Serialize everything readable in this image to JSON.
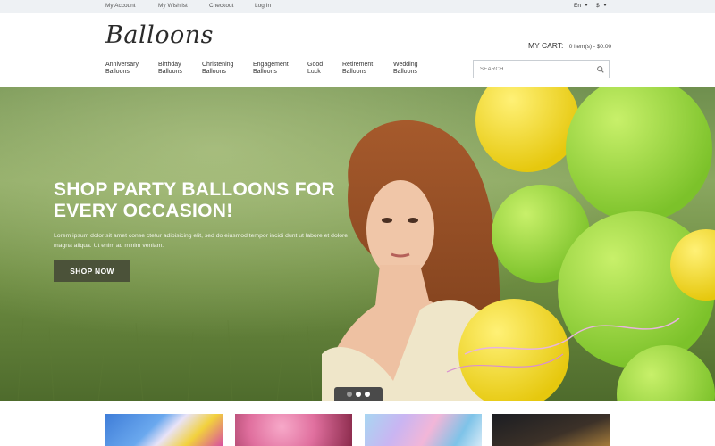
{
  "topbar": {
    "links": [
      "My Account",
      "My Wishlist",
      "Checkout",
      "Log In"
    ],
    "language": "En",
    "currency": "$"
  },
  "logo": "Balloons",
  "cart": {
    "label": "MY CART:",
    "summary": "0 item(s) - $0.00"
  },
  "nav": [
    {
      "line1": "Anniversary",
      "line2": "Balloons"
    },
    {
      "line1": "Birthday",
      "line2": "Balloons"
    },
    {
      "line1": "Christening",
      "line2": "Balloons"
    },
    {
      "line1": "Engagement",
      "line2": "Balloons"
    },
    {
      "line1": "Good",
      "line2": "Luck"
    },
    {
      "line1": "Retirement",
      "line2": "Balloons"
    },
    {
      "line1": "Wedding",
      "line2": "Balloons"
    }
  ],
  "search": {
    "placeholder": "SEARCH"
  },
  "hero": {
    "title": "SHOP PARTY BALLOONS FOR EVERY OCCASION!",
    "text": "Lorem ipsum dolor sit amet conse ctetur adipisicing elit, sed do eiusmod tempor incidi dunt ut labore et dolore magna aliqua. Ut enim ad minim veniam.",
    "button": "SHOP NOW",
    "slides": 3,
    "active_slide": 2
  },
  "colors": {
    "button_bg": "#4b5239",
    "balloon_yellow": "#f2dc1a",
    "balloon_green": "#9fdc3a",
    "topbar_bg": "#eef1f4"
  }
}
